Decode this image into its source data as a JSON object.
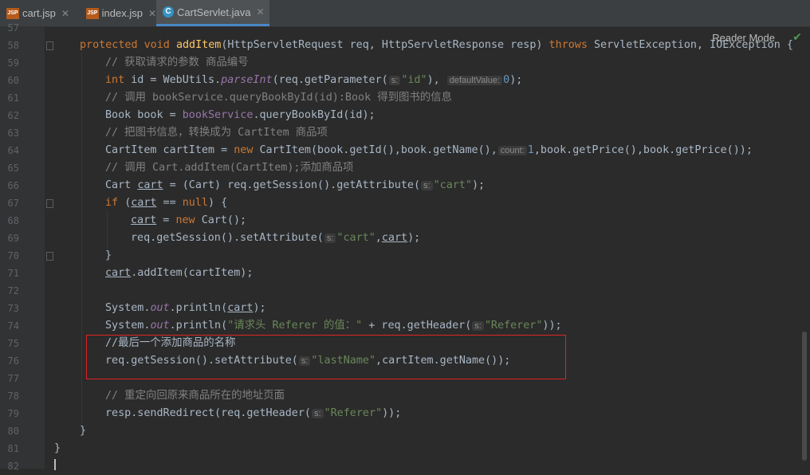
{
  "tabs": [
    {
      "label": "cart.jsp",
      "icon": "jsp-file-icon",
      "active": false
    },
    {
      "label": "index.jsp",
      "icon": "jsp-file-icon",
      "active": false
    },
    {
      "label": "CartServlet.java",
      "icon": "java-class-icon",
      "active": true
    }
  ],
  "editor": {
    "reader_mode": "Reader Mode",
    "line_numbers": [
      "57",
      "58",
      "59",
      "60",
      "61",
      "62",
      "63",
      "64",
      "65",
      "66",
      "67",
      "68",
      "69",
      "70",
      "71",
      "72",
      "73",
      "74",
      "75",
      "76",
      "77",
      "78",
      "79",
      "80",
      "81",
      "82"
    ],
    "hints": {
      "s": "s:",
      "defaultValue": "defaultValue:",
      "count": "count:"
    },
    "lines": {
      "l58_a": "protected void ",
      "l58_b": "addItem",
      "l58_c": "(HttpServletRequest req, HttpServletResponse resp) ",
      "l58_d": "throws ",
      "l58_e": "ServletException, IOException {",
      "l59": "// 获取请求的参数 商品编号",
      "l60_a": "int ",
      "l60_b": "id = WebUtils.",
      "l60_c": "parseInt",
      "l60_d": "(req.getParameter(",
      "l60_e": "\"id\"",
      "l60_f": "), ",
      "l60_g": "0",
      "l60_h": ");",
      "l61": "// 调用 bookService.queryBookById(id):Book 得到图书的信息",
      "l62_a": "Book book = ",
      "l62_b": "bookService",
      "l62_c": ".queryBookById(id);",
      "l63": "// 把图书信息，转换成为 CartItem 商品项",
      "l64_a": "CartItem cartItem = ",
      "l64_b": "new ",
      "l64_c": "CartItem(book.getId(),book.getName(),",
      "l64_d": "1",
      "l64_e": ",book.getPrice(),book.getPrice());",
      "l65": "// 调用 Cart.addItem(CartItem);添加商品项",
      "l66_a": "Cart ",
      "l66_b": "cart",
      "l66_c": " = (Cart) req.getSession().getAttribute(",
      "l66_d": "\"cart\"",
      "l66_e": ");",
      "l67_a": "if ",
      "l67_b": "(",
      "l67_c": "cart",
      "l67_d": " == ",
      "l67_e": "null",
      "l67_f": ") {",
      "l68_a": "cart",
      "l68_b": " = ",
      "l68_c": "new ",
      "l68_d": "Cart();",
      "l69_a": "req.getSession().setAttribute(",
      "l69_b": "\"cart\"",
      "l69_c": ",",
      "l69_d": "cart",
      "l69_e": ");",
      "l70": "}",
      "l71_a": "cart",
      "l71_b": ".addItem(cartItem);",
      "l73_a": "System.",
      "l73_b": "out",
      "l73_c": ".println(",
      "l73_d": "cart",
      "l73_e": ");",
      "l74_a": "System.",
      "l74_b": "out",
      "l74_c": ".println(",
      "l74_d": "\"请求头 Referer 的值：\"",
      "l74_e": " + req.getHeader(",
      "l74_f": "\"Referer\"",
      "l74_g": "));",
      "l75": "//最后一个添加商品的名称",
      "l76_a": "req.getSession().setAttribute(",
      "l76_b": "\"lastName\"",
      "l76_c": ",cartItem.getName());",
      "l78": "// 重定向回原来商品所在的地址页面",
      "l79_a": "resp.sendRedirect(req.getHeader(",
      "l79_b": "\"Referer\"",
      "l79_c": "));",
      "l80": "}",
      "l81": "}"
    }
  },
  "colors": {
    "background": "#2b2b2b",
    "keyword": "#cc7832",
    "method": "#ffc66d",
    "comment": "#808080",
    "string": "#6a8759",
    "number": "#6897bb",
    "field": "#9876aa",
    "highlight_box": "#e02424"
  }
}
